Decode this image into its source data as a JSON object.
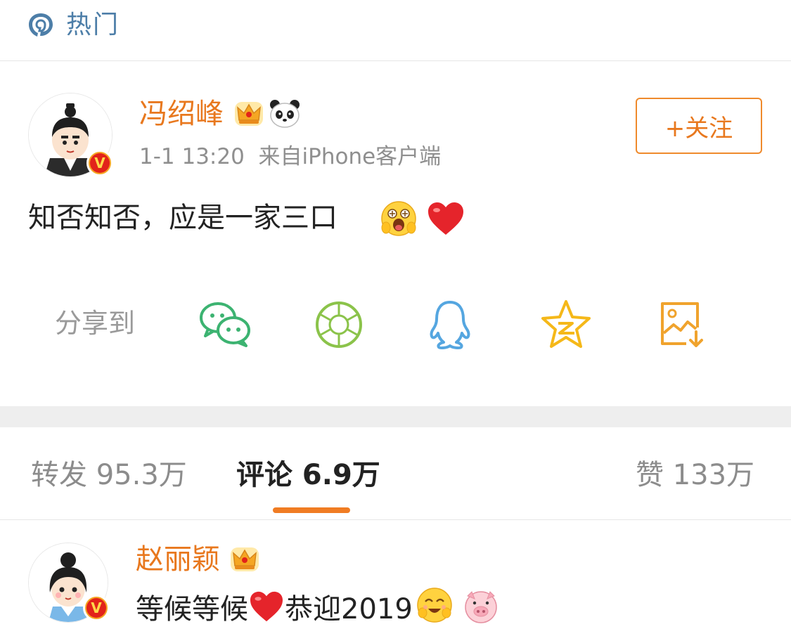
{
  "header": {
    "title": "热门",
    "icon": "hot-topic-icon"
  },
  "post": {
    "author": "冯绍峰",
    "time": "1-1 13:20",
    "source": "来自iPhone客户端",
    "follow_label": "+关注",
    "text": "知否知否，应是一家三口",
    "badges": [
      "crown-badge-icon",
      "panda-badge-icon"
    ]
  },
  "share": {
    "label": "分享到",
    "targets": [
      "wechat-icon",
      "moments-icon",
      "qq-icon",
      "qzone-icon",
      "save-image-icon"
    ]
  },
  "tabs": {
    "repost": "转发 95.3万",
    "comment": "评论 6.9万",
    "like": "赞 133万"
  },
  "comment": {
    "author": "赵丽颖",
    "text_a": "等候等候",
    "text_b": "恭迎2019"
  },
  "colors": {
    "accent": "#e8781e",
    "link_blue": "#4d7ea8",
    "wechat_green": "#3cb371",
    "qq_blue": "#55a6e0",
    "qzone_yellow": "#f5b819"
  }
}
